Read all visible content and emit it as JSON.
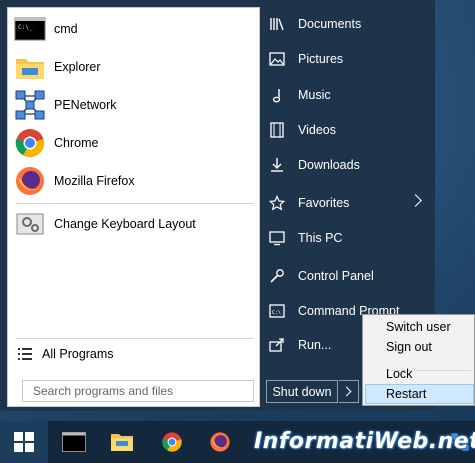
{
  "programs": [
    {
      "label": "cmd",
      "icon": "cmd-icon"
    },
    {
      "label": "Explorer",
      "icon": "folder-icon"
    },
    {
      "label": "PENetwork",
      "icon": "network-icon"
    },
    {
      "label": "Chrome",
      "icon": "chrome-icon"
    },
    {
      "label": "Mozilla Firefox",
      "icon": "firefox-icon"
    },
    {
      "label": "Change Keyboard Layout",
      "icon": "keyboard-settings-icon"
    }
  ],
  "all_programs": "All Programs",
  "search": {
    "placeholder": "Search programs and files"
  },
  "right_menu": [
    {
      "label": "Documents",
      "icon": "books-icon"
    },
    {
      "label": "Pictures",
      "icon": "picture-icon"
    },
    {
      "label": "Music",
      "icon": "music-note-icon"
    },
    {
      "label": "Videos",
      "icon": "film-icon"
    },
    {
      "label": "Downloads",
      "icon": "download-icon"
    },
    {
      "label": "Favorites",
      "icon": "star-icon"
    },
    {
      "label": "This PC",
      "icon": "monitor-icon"
    },
    {
      "label": "Control Panel",
      "icon": "control-panel-icon"
    },
    {
      "label": "Command Prompt",
      "icon": "cmd-small-icon"
    },
    {
      "label": "Run...",
      "icon": "run-icon"
    }
  ],
  "shutdown": {
    "label": "Shut down"
  },
  "context_menu": [
    {
      "label": "Switch user"
    },
    {
      "label": "Sign out"
    },
    {
      "label": "Lock"
    },
    {
      "label": "Restart"
    }
  ],
  "taskbar": {
    "watermark": "InformatiWeb.net"
  },
  "colors": {
    "menu_bg": "#1e344b",
    "highlight": "#cde8ff",
    "taskbar": "#13283d"
  }
}
